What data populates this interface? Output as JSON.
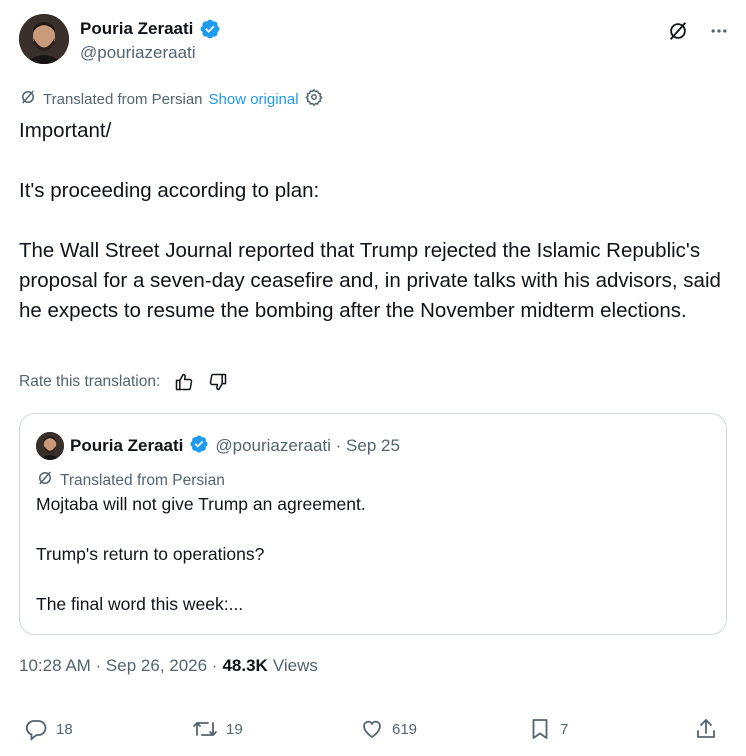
{
  "author": {
    "display_name": "Pouria Zeraati",
    "handle": "@pouriazeraati"
  },
  "translation": {
    "label": "Translated from Persian",
    "show_original": "Show original"
  },
  "tweet": {
    "paragraphs": [
      "Important/",
      "It's proceeding according to plan:",
      "The Wall Street Journal reported that Trump rejected the Islamic Republic's proposal for a seven-day ceasefire and, in private talks with his advisors, said he expects to resume the bombing after the November midterm elections."
    ]
  },
  "rate": {
    "label": "Rate this translation:"
  },
  "quote": {
    "display_name": "Pouria Zeraati",
    "meta": "@pouriazeraati · Sep 25",
    "translated_label": "Translated from Persian",
    "lines": [
      "Mojtaba will not give Trump an agreement.",
      "Trump's return to operations?",
      "The final word this week:..."
    ]
  },
  "meta": {
    "time": "10:28 AM · Sep 26, 2026 ·",
    "views_count": "48.3K",
    "views_label": "Views"
  },
  "actions": {
    "replies": "18",
    "reposts": "19",
    "likes": "619",
    "bookmarks": "7"
  },
  "colors": {
    "accent": "#1d9bf0",
    "secondary_text": "#536471",
    "border": "#cfd9de"
  }
}
